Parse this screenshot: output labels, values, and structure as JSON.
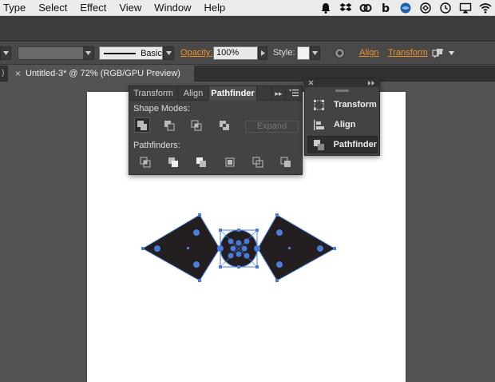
{
  "menubar": {
    "items": [
      "Type",
      "Select",
      "Effect",
      "View",
      "Window",
      "Help"
    ]
  },
  "control_bar": {
    "stroke_profile": "Basic",
    "opacity_label": "Opacity:",
    "opacity_value": "100%",
    "style_label": "Style:",
    "align_link": "Align",
    "transform_link": "Transform"
  },
  "tabs": {
    "prev_tab_fragment": ")",
    "close_icon_char": "×",
    "document_title": "Untitled-3* @ 72% (RGB/GPU Preview)"
  },
  "pathfinder_panel": {
    "tabs": [
      "Transform",
      "Align",
      "Pathfinder"
    ],
    "active_tab": "Pathfinder",
    "shape_modes_label": "Shape Modes:",
    "expand_label": "Expand",
    "pathfinders_label": "Pathfinders:",
    "overflow_glyph": "▸▸"
  },
  "dock_panel": {
    "items": [
      "Transform",
      "Align",
      "Pathfinder"
    ],
    "active_item": "Pathfinder"
  },
  "colors": {
    "accent_orange": "#f0922c",
    "selection_blue": "#4a7bd9",
    "shape_fill": "#231f20",
    "ui_dark": "#434343"
  }
}
